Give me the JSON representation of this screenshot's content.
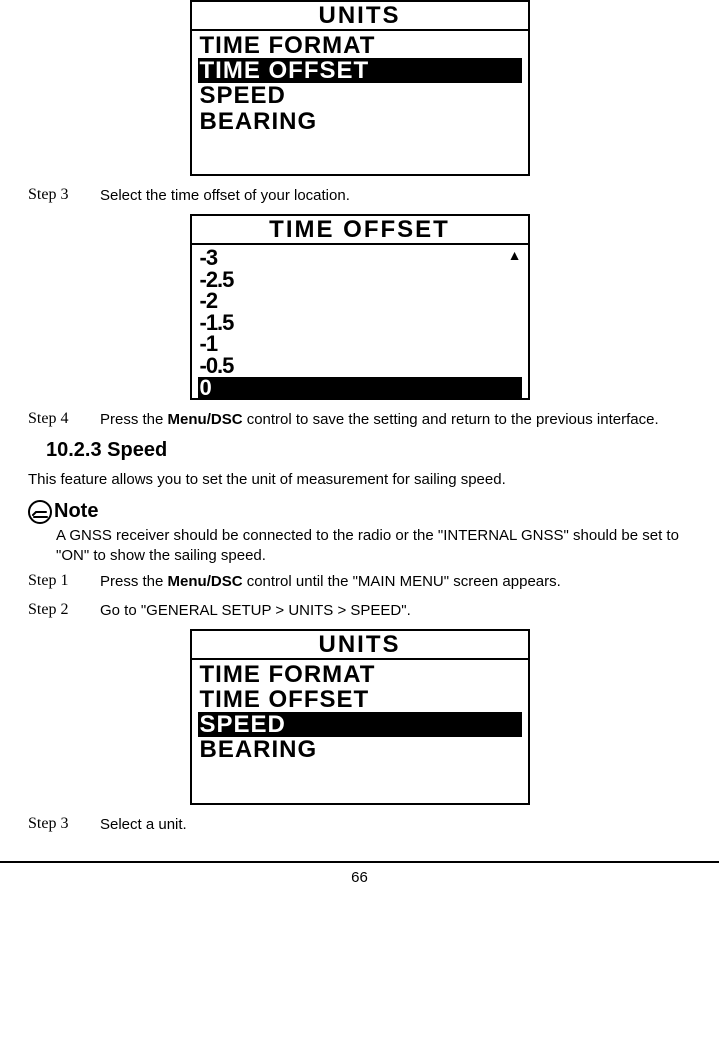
{
  "screen1": {
    "title": "UNITS",
    "items": [
      "TIME FORMAT",
      "TIME OFFSET",
      "SPEED",
      "BEARING"
    ],
    "highlight_index": 1
  },
  "step3a": {
    "label": "Step 3",
    "text": "Select the time offset of your location."
  },
  "screen2": {
    "title": "TIME OFFSET",
    "items": [
      "-3",
      "-2.5",
      "-2",
      "-1.5",
      "-1",
      "-0.5",
      "0"
    ],
    "highlight_index": 6
  },
  "step4": {
    "label": "Step 4",
    "prefix": "Press the ",
    "bold": "Menu/DSC",
    "suffix": " control to save the setting and return to the previous interface."
  },
  "section": "10.2.3 Speed",
  "intro": "This feature allows you to set the unit of measurement for sailing speed.",
  "note": {
    "label": "Note",
    "text": "A GNSS receiver should be connected to the radio or the \"INTERNAL GNSS\" should be set to \"ON\" to show the sailing speed."
  },
  "step1": {
    "label": "Step 1",
    "prefix": "Press the ",
    "bold": "Menu/DSC",
    "suffix": " control until the \"MAIN MENU\" screen appears."
  },
  "step2": {
    "label": "Step 2",
    "text": "Go to \"GENERAL SETUP > UNITS > SPEED\"."
  },
  "screen3": {
    "title": "UNITS",
    "items": [
      "TIME FORMAT",
      "TIME OFFSET",
      "SPEED",
      "BEARING"
    ],
    "highlight_index": 2
  },
  "step3b": {
    "label": "Step 3",
    "text": "Select a unit."
  },
  "page_number": "66"
}
